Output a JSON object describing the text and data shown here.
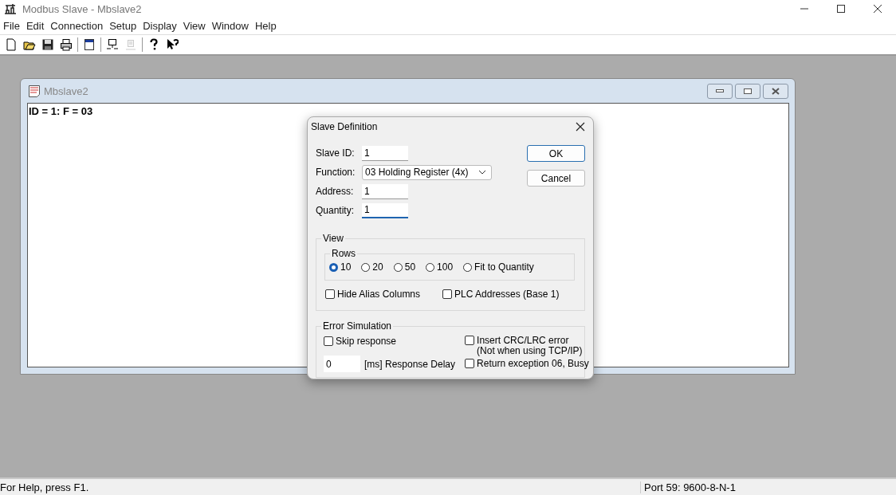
{
  "window": {
    "title": "Modbus Slave - Mbslave2"
  },
  "menu": [
    "File",
    "Edit",
    "Connection",
    "Setup",
    "Display",
    "View",
    "Window",
    "Help"
  ],
  "toolbar": [
    {
      "kind": "new",
      "disabled": false
    },
    {
      "kind": "open",
      "disabled": false
    },
    {
      "kind": "save",
      "disabled": false
    },
    {
      "kind": "print",
      "disabled": false
    },
    {
      "kind": "sep"
    },
    {
      "kind": "window",
      "disabled": false
    },
    {
      "kind": "sep"
    },
    {
      "kind": "connect",
      "disabled": false
    },
    {
      "kind": "disconnect",
      "disabled": true
    },
    {
      "kind": "sep"
    },
    {
      "kind": "help",
      "disabled": false
    },
    {
      "kind": "context-help",
      "disabled": false
    }
  ],
  "child_window": {
    "title": "Mbslave2",
    "content": "ID = 1: F = 03"
  },
  "dialog": {
    "title": "Slave Definition",
    "fields": [
      {
        "label": "Slave ID:",
        "value": "1",
        "kind": "text",
        "focused": false
      },
      {
        "label": "Function:",
        "value": "03 Holding Register (4x)",
        "kind": "select"
      },
      {
        "label": "Address:",
        "value": "1",
        "kind": "text",
        "focused": false
      },
      {
        "label": "Quantity:",
        "value": "1",
        "kind": "text",
        "focused": true
      }
    ],
    "buttons": [
      {
        "label": "OK",
        "default": true
      },
      {
        "label": "Cancel",
        "default": false
      }
    ],
    "view": {
      "title": "View",
      "rows_title": "Rows",
      "rows": [
        {
          "label": "10",
          "selected": true
        },
        {
          "label": "20",
          "selected": false
        },
        {
          "label": "50",
          "selected": false
        },
        {
          "label": "100",
          "selected": false
        },
        {
          "label": "Fit to Quantity",
          "selected": false
        }
      ],
      "checkboxes": [
        {
          "label": "Hide Alias Columns",
          "checked": false
        },
        {
          "label": "PLC Addresses (Base 1)",
          "checked": false
        }
      ]
    },
    "error_simulation": {
      "title": "Error Simulation",
      "skip_response": {
        "label": "Skip response",
        "checked": false
      },
      "delay": {
        "value": "0",
        "label": "[ms] Response Delay"
      },
      "crc_error": {
        "label": "Insert CRC/LRC error",
        "note": "(Not when using TCP/IP)",
        "checked": false
      },
      "busy": {
        "label": "Return exception 06, Busy",
        "checked": false
      }
    }
  },
  "status_bar": {
    "help": "For Help, press F1.",
    "port": "Port 59: 9600-8-N-1"
  }
}
